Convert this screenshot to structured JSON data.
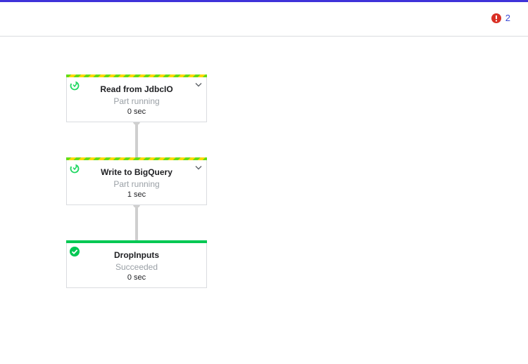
{
  "colors": {
    "top_bar": "#3f32d9",
    "error_red": "#d93025",
    "error_count_text": "#3c4bd6",
    "running_green": "#1ed760",
    "success_green": "#00c853"
  },
  "header": {
    "error_icon": "error-circle-icon",
    "error_count": "2"
  },
  "graph": {
    "nodes": [
      {
        "name": "Read from JdbcIO",
        "status": "Part running",
        "time": "0 sec",
        "state": "running",
        "expandable": true
      },
      {
        "name": "Write to BigQuery",
        "status": "Part running",
        "time": "1 sec",
        "state": "running",
        "expandable": true
      },
      {
        "name": "DropInputs",
        "status": "Succeeded",
        "time": "0 sec",
        "state": "succeeded",
        "expandable": false
      }
    ]
  }
}
